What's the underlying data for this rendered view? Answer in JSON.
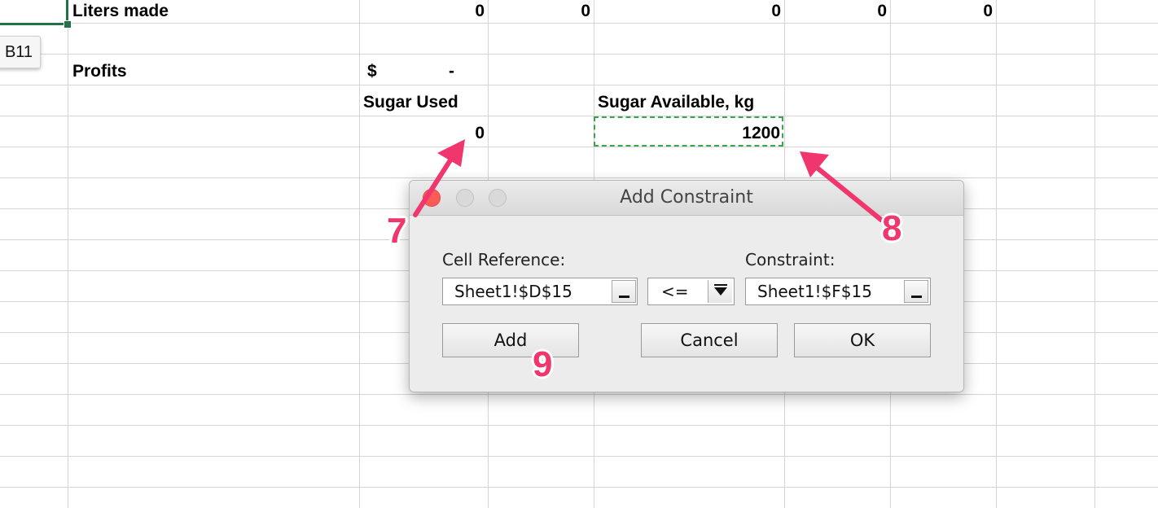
{
  "spreadsheet": {
    "name_box": "B11",
    "rows": {
      "liters_made": {
        "label": "Liters made",
        "values": [
          "0",
          "0",
          "0",
          "0",
          "0"
        ]
      },
      "profits": {
        "label": "Profits",
        "currency": "$",
        "value": "-"
      },
      "sugar_used": {
        "header": "Sugar Used",
        "value": "0"
      },
      "sugar_available": {
        "header": "Sugar Available, kg",
        "value": "1200"
      }
    }
  },
  "dialog": {
    "title": "Add Constraint",
    "cell_reference_label": "Cell Reference:",
    "cell_reference_value": "Sheet1!$D$15",
    "operator_value": "<=",
    "constraint_label": "Constraint:",
    "constraint_value": "Sheet1!$F$15",
    "buttons": {
      "add": "Add",
      "cancel": "Cancel",
      "ok": "OK"
    }
  },
  "annotations": {
    "step_7": "7",
    "step_8": "8",
    "step_9": "9",
    "color": "#f0366d"
  },
  "colors": {
    "selection_green": "#217346",
    "copy_marquee": "#3aa54a",
    "gridline": "#d4d4d4",
    "close_button": "#fb5b55"
  }
}
